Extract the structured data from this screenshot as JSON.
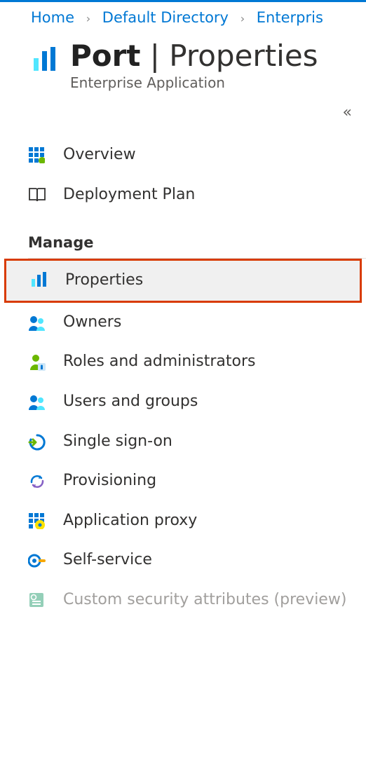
{
  "breadcrumb": {
    "items": [
      "Home",
      "Default Directory",
      "Enterpris"
    ]
  },
  "header": {
    "title_bold": "Port",
    "title_separator": " | ",
    "title_thin": "Properties",
    "subtitle": "Enterprise Application"
  },
  "nav_top": [
    {
      "label": "Overview"
    },
    {
      "label": "Deployment Plan"
    }
  ],
  "section_manage": {
    "title": "Manage"
  },
  "nav_manage": [
    {
      "label": "Properties",
      "selected": true
    },
    {
      "label": "Owners"
    },
    {
      "label": "Roles and administrators"
    },
    {
      "label": "Users and groups"
    },
    {
      "label": "Single sign-on"
    },
    {
      "label": "Provisioning"
    },
    {
      "label": "Application proxy"
    },
    {
      "label": "Self-service"
    },
    {
      "label": "Custom security attributes (preview)",
      "disabled": true
    }
  ]
}
